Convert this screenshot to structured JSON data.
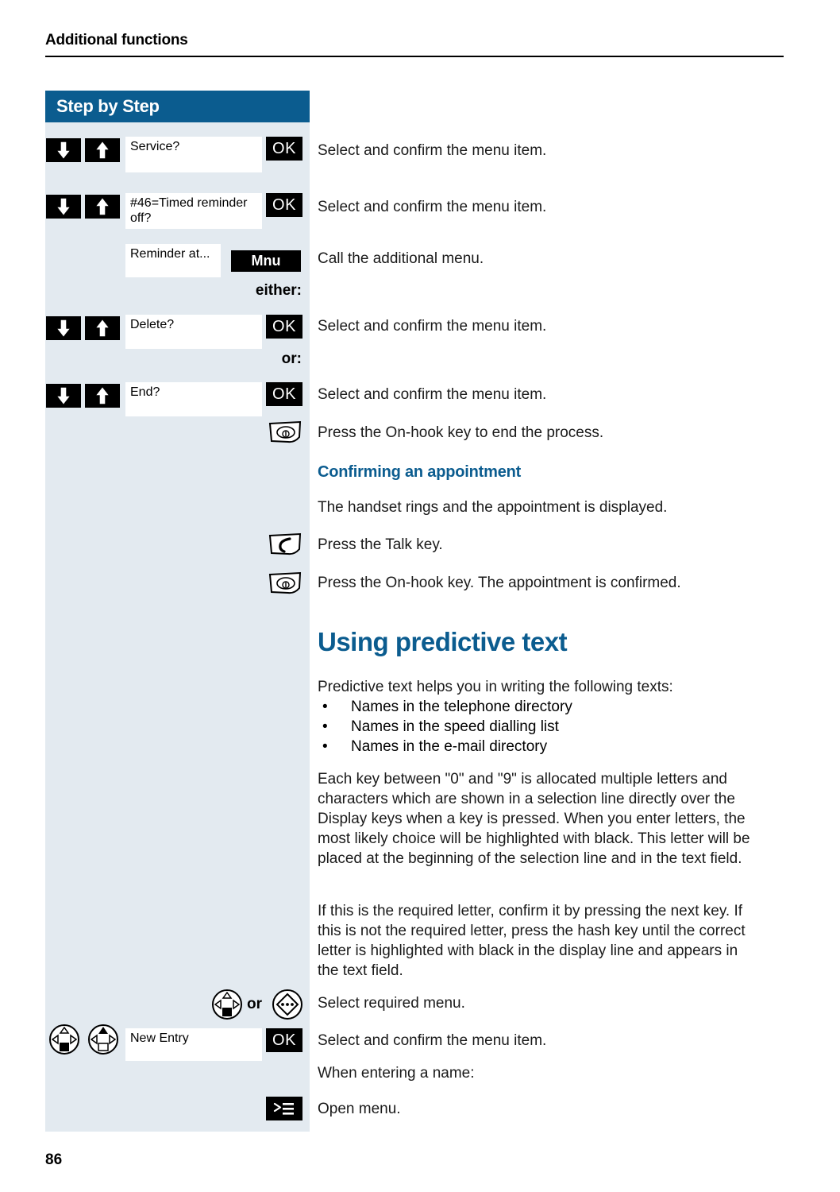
{
  "header": {
    "running_title": "Additional functions"
  },
  "sidebar": {
    "title": "Step by Step"
  },
  "page_number": "86",
  "icons": {
    "down_arrow": "arrow-down-icon",
    "up_arrow": "arrow-up-icon",
    "on_hook": "on-hook-key-icon",
    "talk": "talk-key-icon",
    "menu": "open-menu-icon",
    "nav_key": "navigation-key-icon",
    "nav_key_alt": "navigation-key-alt-icon"
  },
  "colors": {
    "accent": "#0b5c8f",
    "panel": "#e3eaf0",
    "key": "#000000",
    "display": "#ffffff"
  },
  "steps": [
    {
      "id": "service",
      "display": "Service?",
      "softkey": "OK",
      "instruction": "Select and confirm the menu item."
    },
    {
      "id": "timed-reminder-off",
      "display": "#46=Timed reminder off?",
      "softkey": "OK",
      "instruction": "Select and confirm the menu item."
    },
    {
      "id": "reminder-at",
      "display": "Reminder at...",
      "softkey": "Mnu",
      "instruction": "Call the additional menu."
    },
    {
      "id": "delete",
      "display": "Delete?",
      "softkey": "OK",
      "instruction": "Select and confirm the menu item."
    },
    {
      "id": "end",
      "display": "End?",
      "softkey": "OK",
      "instruction": "Select and confirm the menu item."
    }
  ],
  "connectors": {
    "either": "either:",
    "or": "or:",
    "or_inline": "or"
  },
  "instructions": {
    "on_hook_end": "Press the On-hook key to end the process.",
    "talk": "Press the Talk key.",
    "on_hook_confirm": "Press the On-hook key. The appointment is confirmed.",
    "select_required_menu": "Select required menu.",
    "select_confirm_menu_item": "Select and confirm the menu item.",
    "when_entering_name": "When entering a name:",
    "open_menu": "Open menu."
  },
  "confirming_appointment": {
    "heading": "Confirming an appointment",
    "body": "The handset rings and the appointment is displayed."
  },
  "predictive_text": {
    "heading": "Using predictive text",
    "intro": "Predictive text helps you in writing the following texts:",
    "bullets": [
      "Names in the telephone directory",
      "Names in the speed dialling list",
      "Names in the e-mail directory"
    ],
    "paragraph_1": "Each key between \"0\" and \"9\" is allocated multiple letters and characters which are shown in a selection line directly over the Display keys when a key is pressed. When you enter letters, the most likely choice will be highlighted with black. This letter will be placed at the beginning of the selection line and in the text field.",
    "paragraph_2": "If this is the required letter, confirm it by pressing the next key. If this is not the required letter, press the hash key until the correct letter is highlighted with black in the display line and appears in the text field.",
    "new_entry_display": "New Entry",
    "new_entry_softkey": "OK"
  }
}
